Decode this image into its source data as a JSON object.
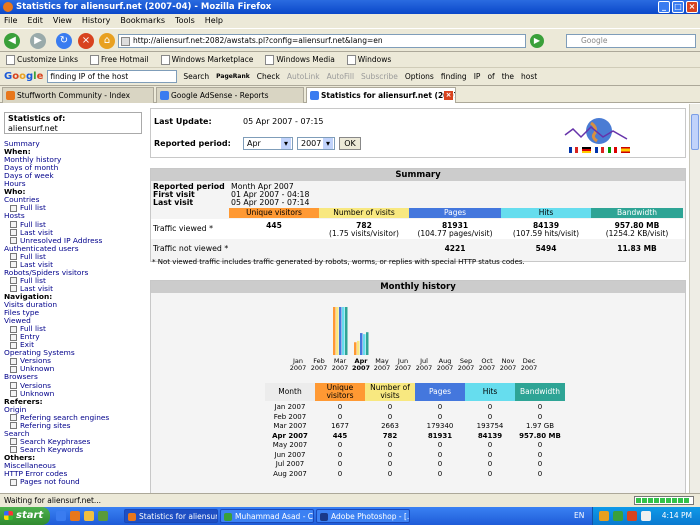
{
  "window": {
    "title": "Statistics for aliensurf.net (2007-04) - Mozilla Firefox"
  },
  "menu": [
    "File",
    "Edit",
    "View",
    "History",
    "Bookmarks",
    "Tools",
    "Help"
  ],
  "nav": {
    "url": "http://aliensurf.net:2082/awstats.pl?config=aliensurf.net&lang=en",
    "search_placeholder": "Google"
  },
  "bookmarks": [
    "Customize Links",
    "Free Hotmail",
    "Windows Marketplace",
    "Windows Media",
    "Windows"
  ],
  "google_toolbar": {
    "logo": "Google",
    "query": "finding IP of the host",
    "items": [
      "Search",
      "PageRank",
      "Check",
      "AutoLink",
      "AutoFill",
      "Subscribe",
      "Options",
      "finding",
      "IP",
      "of",
      "the",
      "host"
    ]
  },
  "tabs": [
    {
      "label": "Stuffworth Community - Index",
      "active": false
    },
    {
      "label": "Google AdSense - Reports",
      "active": false
    },
    {
      "label": "Statistics for aliensurf.net (2007...",
      "active": true
    }
  ],
  "left_menu": {
    "stats_of_label": "Statistics of:",
    "stats_of_value": "aliensurf.net",
    "items": [
      {
        "text": "Summary",
        "type": "link"
      },
      {
        "text": "When:",
        "type": "head"
      },
      {
        "text": "Monthly history",
        "type": "link"
      },
      {
        "text": "Days of month",
        "type": "link"
      },
      {
        "text": "Days of week",
        "type": "link"
      },
      {
        "text": "Hours",
        "type": "link"
      },
      {
        "text": "Who:",
        "type": "head"
      },
      {
        "text": "Countries",
        "type": "link"
      },
      {
        "text": "Full list",
        "type": "sub"
      },
      {
        "text": "Hosts",
        "type": "link"
      },
      {
        "text": "Full list",
        "type": "sub"
      },
      {
        "text": "Last visit",
        "type": "sub"
      },
      {
        "text": "Unresolved IP Address",
        "type": "sub"
      },
      {
        "text": "Authenticated users",
        "type": "link"
      },
      {
        "text": "Full list",
        "type": "sub"
      },
      {
        "text": "Last visit",
        "type": "sub"
      },
      {
        "text": "Robots/Spiders visitors",
        "type": "link"
      },
      {
        "text": "Full list",
        "type": "sub"
      },
      {
        "text": "Last visit",
        "type": "sub"
      },
      {
        "text": "Navigation:",
        "type": "head"
      },
      {
        "text": "Visits duration",
        "type": "link"
      },
      {
        "text": "Files type",
        "type": "link"
      },
      {
        "text": "Viewed",
        "type": "link"
      },
      {
        "text": "Full list",
        "type": "sub"
      },
      {
        "text": "Entry",
        "type": "sub"
      },
      {
        "text": "Exit",
        "type": "sub"
      },
      {
        "text": "Operating Systems",
        "type": "link"
      },
      {
        "text": "Versions",
        "type": "sub"
      },
      {
        "text": "Unknown",
        "type": "sub"
      },
      {
        "text": "Browsers",
        "type": "link"
      },
      {
        "text": "Versions",
        "type": "sub"
      },
      {
        "text": "Unknown",
        "type": "sub"
      },
      {
        "text": "Referers:",
        "type": "head"
      },
      {
        "text": "Origin",
        "type": "link"
      },
      {
        "text": "Refering search engines",
        "type": "sub"
      },
      {
        "text": "Refering sites",
        "type": "sub"
      },
      {
        "text": "Search",
        "type": "link"
      },
      {
        "text": "Search Keyphrases",
        "type": "sub"
      },
      {
        "text": "Search Keywords",
        "type": "sub"
      },
      {
        "text": "Others:",
        "type": "head"
      },
      {
        "text": "Miscellaneous",
        "type": "link"
      },
      {
        "text": "HTTP Error codes",
        "type": "link"
      },
      {
        "text": "Pages not found",
        "type": "sub"
      }
    ]
  },
  "header_panel": {
    "last_update_label": "Last Update:",
    "last_update_value": "05 Apr 2007 - 07:15",
    "reported_period_label": "Reported period:",
    "month_select": "Apr",
    "year_select": "2007",
    "ok_label": "OK"
  },
  "summary": {
    "title": "Summary",
    "reported_period_label": "Reported period",
    "reported_period_value": "Month Apr 2007",
    "first_visit_label": "First visit",
    "first_visit_value": "01 Apr 2007 - 04:18",
    "last_visit_label": "Last visit",
    "last_visit_value": "05 Apr 2007 - 07:14",
    "columns": [
      "Unique visitors",
      "Number of visits",
      "Pages",
      "Hits",
      "Bandwidth"
    ],
    "column_colors": [
      "#ff9933",
      "#f8e880",
      "#4477dd",
      "#66ddee",
      "#2ea495"
    ],
    "traffic_viewed_label": "Traffic viewed *",
    "traffic_viewed": {
      "unique": "445",
      "visits": "782",
      "visits_sub": "(1.75 visits/visitor)",
      "pages": "81931",
      "pages_sub": "(104.77 pages/visit)",
      "hits": "84139",
      "hits_sub": "(107.59 hits/visit)",
      "bandwidth": "957.80 MB",
      "bandwidth_sub": "(1254.2 KB/visit)"
    },
    "traffic_not_viewed_label": "Traffic not viewed *",
    "traffic_not_viewed": {
      "pages": "4221",
      "hits": "5494",
      "bandwidth": "11.83 MB"
    },
    "footnote": "* Not viewed traffic includes traffic generated by robots, worms, or replies with special HTTP status codes."
  },
  "monthly": {
    "title": "Monthly history",
    "table_headers": [
      "Month",
      "Unique visitors",
      "Number of visits",
      "Pages",
      "Hits",
      "Bandwidth"
    ],
    "rows": [
      [
        "Jan 2007",
        "0",
        "0",
        "0",
        "0",
        "0"
      ],
      [
        "Feb 2007",
        "0",
        "0",
        "0",
        "0",
        "0"
      ],
      [
        "Mar 2007",
        "1677",
        "2663",
        "179340",
        "193754",
        "1.97 GB"
      ],
      [
        "Apr 2007",
        "445",
        "782",
        "81931",
        "84139",
        "957.80 MB"
      ],
      [
        "May 2007",
        "0",
        "0",
        "0",
        "0",
        "0"
      ],
      [
        "Jun 2007",
        "0",
        "0",
        "0",
        "0",
        "0"
      ],
      [
        "Jul 2007",
        "0",
        "0",
        "0",
        "0",
        "0"
      ],
      [
        "Aug 2007",
        "0",
        "0",
        "0",
        "0",
        "0"
      ]
    ]
  },
  "chart_data": {
    "type": "bar",
    "categories": [
      "Jan 2007",
      "Feb 2007",
      "Mar 2007",
      "Apr 2007",
      "May 2007",
      "Jun 2007",
      "Jul 2007",
      "Aug 2007",
      "Sep 2007",
      "Oct 2007",
      "Nov 2007",
      "Dec 2007"
    ],
    "tick_months": [
      "Jan",
      "Feb",
      "Mar",
      "Apr",
      "May",
      "Jun",
      "Jul",
      "Aug",
      "Sep",
      "Oct",
      "Nov",
      "Dec"
    ],
    "tick_year": "2007",
    "highlight": "Apr",
    "series": [
      {
        "name": "Unique visitors",
        "values": [
          0,
          0,
          1677,
          445,
          0,
          0,
          0,
          0,
          0,
          0,
          0,
          0
        ],
        "color": "#ff9933"
      },
      {
        "name": "Number of visits",
        "values": [
          0,
          0,
          2663,
          782,
          0,
          0,
          0,
          0,
          0,
          0,
          0,
          0
        ],
        "color": "#f8e880"
      },
      {
        "name": "Pages",
        "values": [
          0,
          0,
          179340,
          81931,
          0,
          0,
          0,
          0,
          0,
          0,
          0,
          0
        ],
        "color": "#4477dd"
      },
      {
        "name": "Hits",
        "values": [
          0,
          0,
          193754,
          84139,
          0,
          0,
          0,
          0,
          0,
          0,
          0,
          0
        ],
        "color": "#66ddee"
      },
      {
        "name": "Bandwidth",
        "values": [
          0,
          0,
          2017.28,
          957.8,
          0,
          0,
          0,
          0,
          0,
          0,
          0,
          0
        ],
        "color": "#2ea495"
      }
    ]
  },
  "status": {
    "text": "Waiting for aliensurf.net...",
    "progress": 0.95
  },
  "taskbar": {
    "start": "start",
    "tasks": [
      {
        "label": "Statistics for aliensurf...",
        "active": true
      },
      {
        "label": "Muhammad Asad - Co...",
        "active": false
      },
      {
        "label": "Adobe Photoshop - [...",
        "active": false
      }
    ],
    "lang": "EN",
    "clock": "4:14 PM"
  },
  "colors": {
    "link": "#00008b",
    "section_header": "#cccccc",
    "titlebar": "#0a47c9"
  }
}
